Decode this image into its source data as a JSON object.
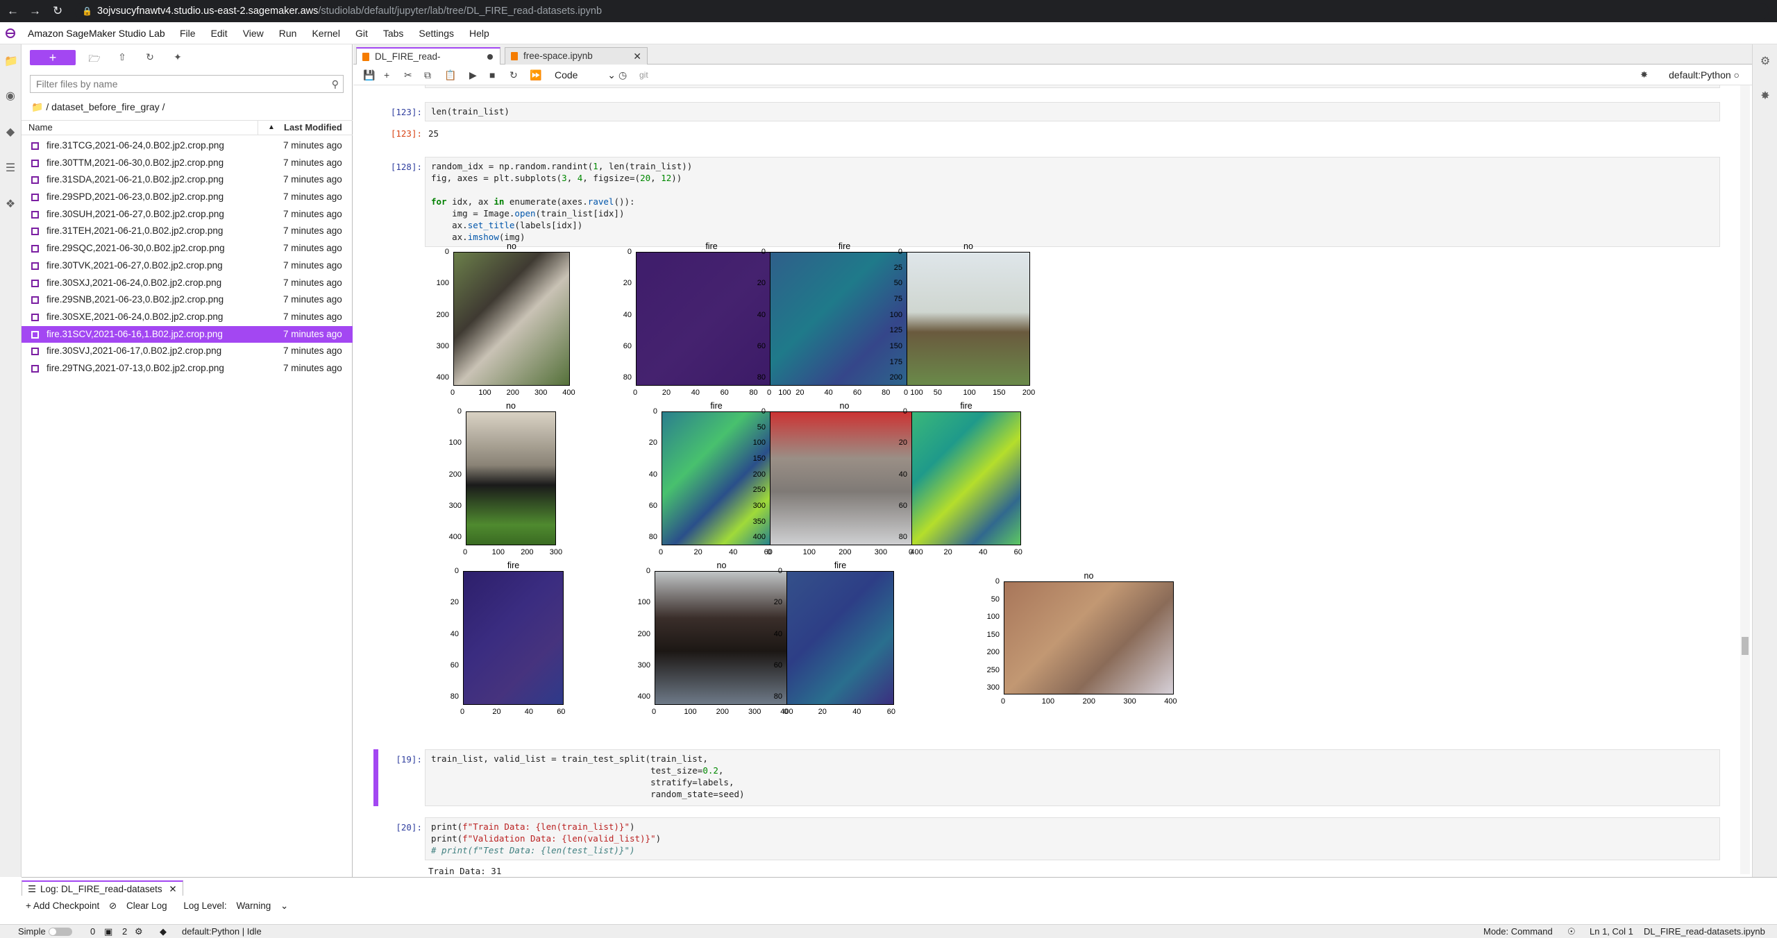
{
  "browser": {
    "url_host": "3ojvsucyfnawtv4.studio.us-east-2.sagemaker.aws",
    "url_path": "/studiolab/default/jupyter/lab/tree/DL_FIRE_read-datasets.ipynb"
  },
  "app": {
    "title": "Amazon SageMaker Studio Lab",
    "menu": [
      "File",
      "Edit",
      "View",
      "Run",
      "Kernel",
      "Git",
      "Tabs",
      "Settings",
      "Help"
    ]
  },
  "filebrowser": {
    "new_label": "+",
    "filter_placeholder": "Filter files by name",
    "breadcrumb": "/ dataset_before_fire_gray /",
    "col_name": "Name",
    "col_modified": "Last Modified",
    "files": [
      {
        "name": "fire.31TCG,2021-06-24,0.B02.jp2.crop.png",
        "modified": "7 minutes ago",
        "selected": false
      },
      {
        "name": "fire.30TTM,2021-06-30,0.B02.jp2.crop.png",
        "modified": "7 minutes ago",
        "selected": false
      },
      {
        "name": "fire.31SDA,2021-06-21,0.B02.jp2.crop.png",
        "modified": "7 minutes ago",
        "selected": false
      },
      {
        "name": "fire.29SPD,2021-06-23,0.B02.jp2.crop.png",
        "modified": "7 minutes ago",
        "selected": false
      },
      {
        "name": "fire.30SUH,2021-06-27,0.B02.jp2.crop.png",
        "modified": "7 minutes ago",
        "selected": false
      },
      {
        "name": "fire.31TEH,2021-06-21,0.B02.jp2.crop.png",
        "modified": "7 minutes ago",
        "selected": false
      },
      {
        "name": "fire.29SQC,2021-06-30,0.B02.jp2.crop.png",
        "modified": "7 minutes ago",
        "selected": false
      },
      {
        "name": "fire.30TVK,2021-06-27,0.B02.jp2.crop.png",
        "modified": "7 minutes ago",
        "selected": false
      },
      {
        "name": "fire.30SXJ,2021-06-24,0.B02.jp2.crop.png",
        "modified": "7 minutes ago",
        "selected": false
      },
      {
        "name": "fire.29SNB,2021-06-23,0.B02.jp2.crop.png",
        "modified": "7 minutes ago",
        "selected": false
      },
      {
        "name": "fire.30SXE,2021-06-24,0.B02.jp2.crop.png",
        "modified": "7 minutes ago",
        "selected": false
      },
      {
        "name": "fire.31SCV,2021-06-16,1.B02.jp2.crop.png",
        "modified": "7 minutes ago",
        "selected": true
      },
      {
        "name": "fire.30SVJ,2021-06-17,0.B02.jp2.crop.png",
        "modified": "7 minutes ago",
        "selected": false
      },
      {
        "name": "fire.29TNG,2021-07-13,0.B02.jp2.crop.png",
        "modified": "7 minutes ago",
        "selected": false
      }
    ]
  },
  "tabs": [
    {
      "label": "DL_FIRE_read-datasets.ipynb",
      "active": true
    },
    {
      "label": "free-space.ipynb",
      "active": false
    }
  ],
  "toolbar": {
    "cell_type": "Code",
    "git_label": "git",
    "kernel": "default:Python"
  },
  "cells": {
    "c1_prompt": "[123]:",
    "c1_code": "len(train_list)",
    "c1_out_prompt": "[123]:",
    "c1_out": "25",
    "c2_prompt": "[128]:",
    "c3_prompt": "[19]:",
    "c4_prompt": "[20]:",
    "c4_out": "Train Data: 31"
  },
  "figure": {
    "titles": [
      "no",
      "fire",
      "fire",
      "no",
      "no",
      "fire",
      "no",
      "fire",
      "fire",
      "no",
      "fire",
      "no"
    ],
    "panels": [
      {
        "xt": [
          "0",
          "100",
          "200",
          "300",
          "400"
        ],
        "yt": [
          "0",
          "100",
          "200",
          "300",
          "400"
        ]
      },
      {
        "xt": [
          "0",
          "20",
          "40",
          "60",
          "80",
          "100"
        ],
        "yt": [
          "0",
          "20",
          "40",
          "60",
          "80"
        ]
      },
      {
        "xt": [
          "0",
          "20",
          "40",
          "60",
          "80",
          "100"
        ],
        "yt": [
          "0",
          "20",
          "40",
          "60",
          "80"
        ]
      },
      {
        "xt": [
          "0",
          "50",
          "100",
          "150",
          "200"
        ],
        "yt": [
          "0",
          "25",
          "50",
          "75",
          "100",
          "125",
          "150",
          "175",
          "200"
        ]
      },
      {
        "xt": [
          "0",
          "100",
          "200",
          "300"
        ],
        "yt": [
          "0",
          "100",
          "200",
          "300",
          "400"
        ]
      },
      {
        "xt": [
          "0",
          "20",
          "40",
          "60"
        ],
        "yt": [
          "0",
          "20",
          "40",
          "60",
          "80"
        ]
      },
      {
        "xt": [
          "0",
          "100",
          "200",
          "300",
          "400"
        ],
        "yt": [
          "0",
          "50",
          "100",
          "150",
          "200",
          "250",
          "300",
          "350",
          "400"
        ]
      },
      {
        "xt": [
          "0",
          "20",
          "40",
          "60"
        ],
        "yt": [
          "0",
          "20",
          "40",
          "60",
          "80"
        ]
      },
      {
        "xt": [
          "0",
          "20",
          "40",
          "60"
        ],
        "yt": [
          "0",
          "20",
          "40",
          "60",
          "80"
        ]
      },
      {
        "xt": [
          "0",
          "100",
          "200",
          "300",
          "400"
        ],
        "yt": [
          "0",
          "100",
          "200",
          "300",
          "400"
        ]
      },
      {
        "xt": [
          "0",
          "20",
          "40",
          "60"
        ],
        "yt": [
          "0",
          "20",
          "40",
          "60",
          "80"
        ]
      },
      {
        "xt": [
          "0",
          "100",
          "200",
          "300",
          "400"
        ],
        "yt": [
          "0",
          "50",
          "100",
          "150",
          "200",
          "250",
          "300"
        ]
      }
    ]
  },
  "log": {
    "tab_label": "Log: DL_FIRE_read-datasets",
    "add_checkpoint": "+ Add Checkpoint",
    "clear_log": "Clear Log",
    "log_level_label": "Log Level:",
    "log_level_value": "Warning"
  },
  "status": {
    "mode_label": "Simple",
    "count_a": "0",
    "count_b": "2",
    "kernel_status": "default:Python | Idle",
    "mode": "Mode: Command",
    "position": "Ln 1, Col 1",
    "filename": "DL_FIRE_read-datasets.ipynb"
  },
  "colors": {
    "accent": "#a347f2",
    "prompt_in": "#303f9f",
    "prompt_out": "#d84315"
  }
}
